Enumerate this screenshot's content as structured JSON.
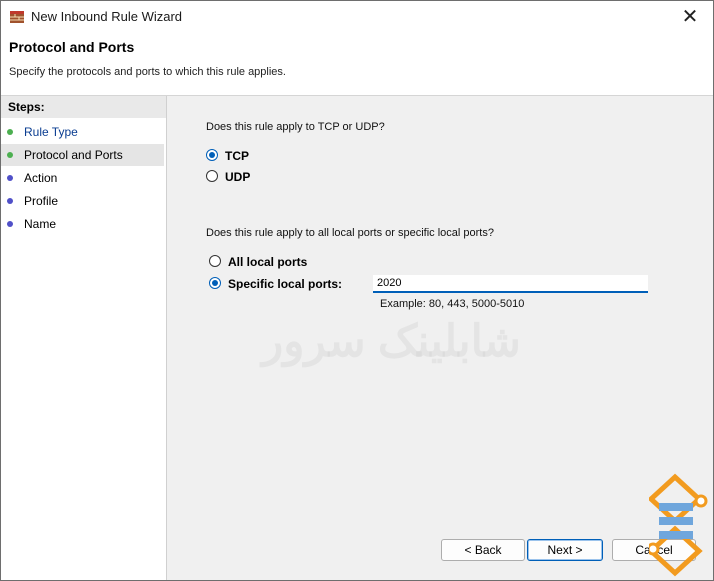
{
  "window": {
    "title": "New Inbound Rule Wizard",
    "close_glyph": "✕"
  },
  "header": {
    "title": "Protocol and Ports",
    "subtitle": "Specify the protocols and ports to which this rule applies."
  },
  "steps": {
    "heading": "Steps:",
    "items": [
      {
        "label": "Rule Type",
        "dot_color": "#4caf50"
      },
      {
        "label": "Protocol and Ports",
        "dot_color": "#4caf50"
      },
      {
        "label": "Action",
        "dot_color": "#5050c8"
      },
      {
        "label": "Profile",
        "dot_color": "#5050c8"
      },
      {
        "label": "Name",
        "dot_color": "#5050c8"
      }
    ]
  },
  "protocol": {
    "question": "Does this rule apply to TCP or UDP?",
    "tcp_label": "TCP",
    "udp_label": "UDP",
    "selected": "TCP"
  },
  "ports": {
    "question": "Does this rule apply to all local ports or specific local ports?",
    "all_label": "All local ports",
    "specific_label": "Specific local ports:",
    "selected": "Specific local ports",
    "value": "2020",
    "example": "Example: 80, 443, 5000-5010"
  },
  "buttons": {
    "back": "< Back",
    "next": "Next >",
    "cancel": "Cancel"
  },
  "watermark": {
    "text": "شابلینک سرور"
  },
  "colors": {
    "accent": "#005fb8",
    "step_done": "#4caf50",
    "step_pending": "#5050c8",
    "logo_orange": "#f29b1f",
    "logo_blue": "#6fa6dc"
  }
}
